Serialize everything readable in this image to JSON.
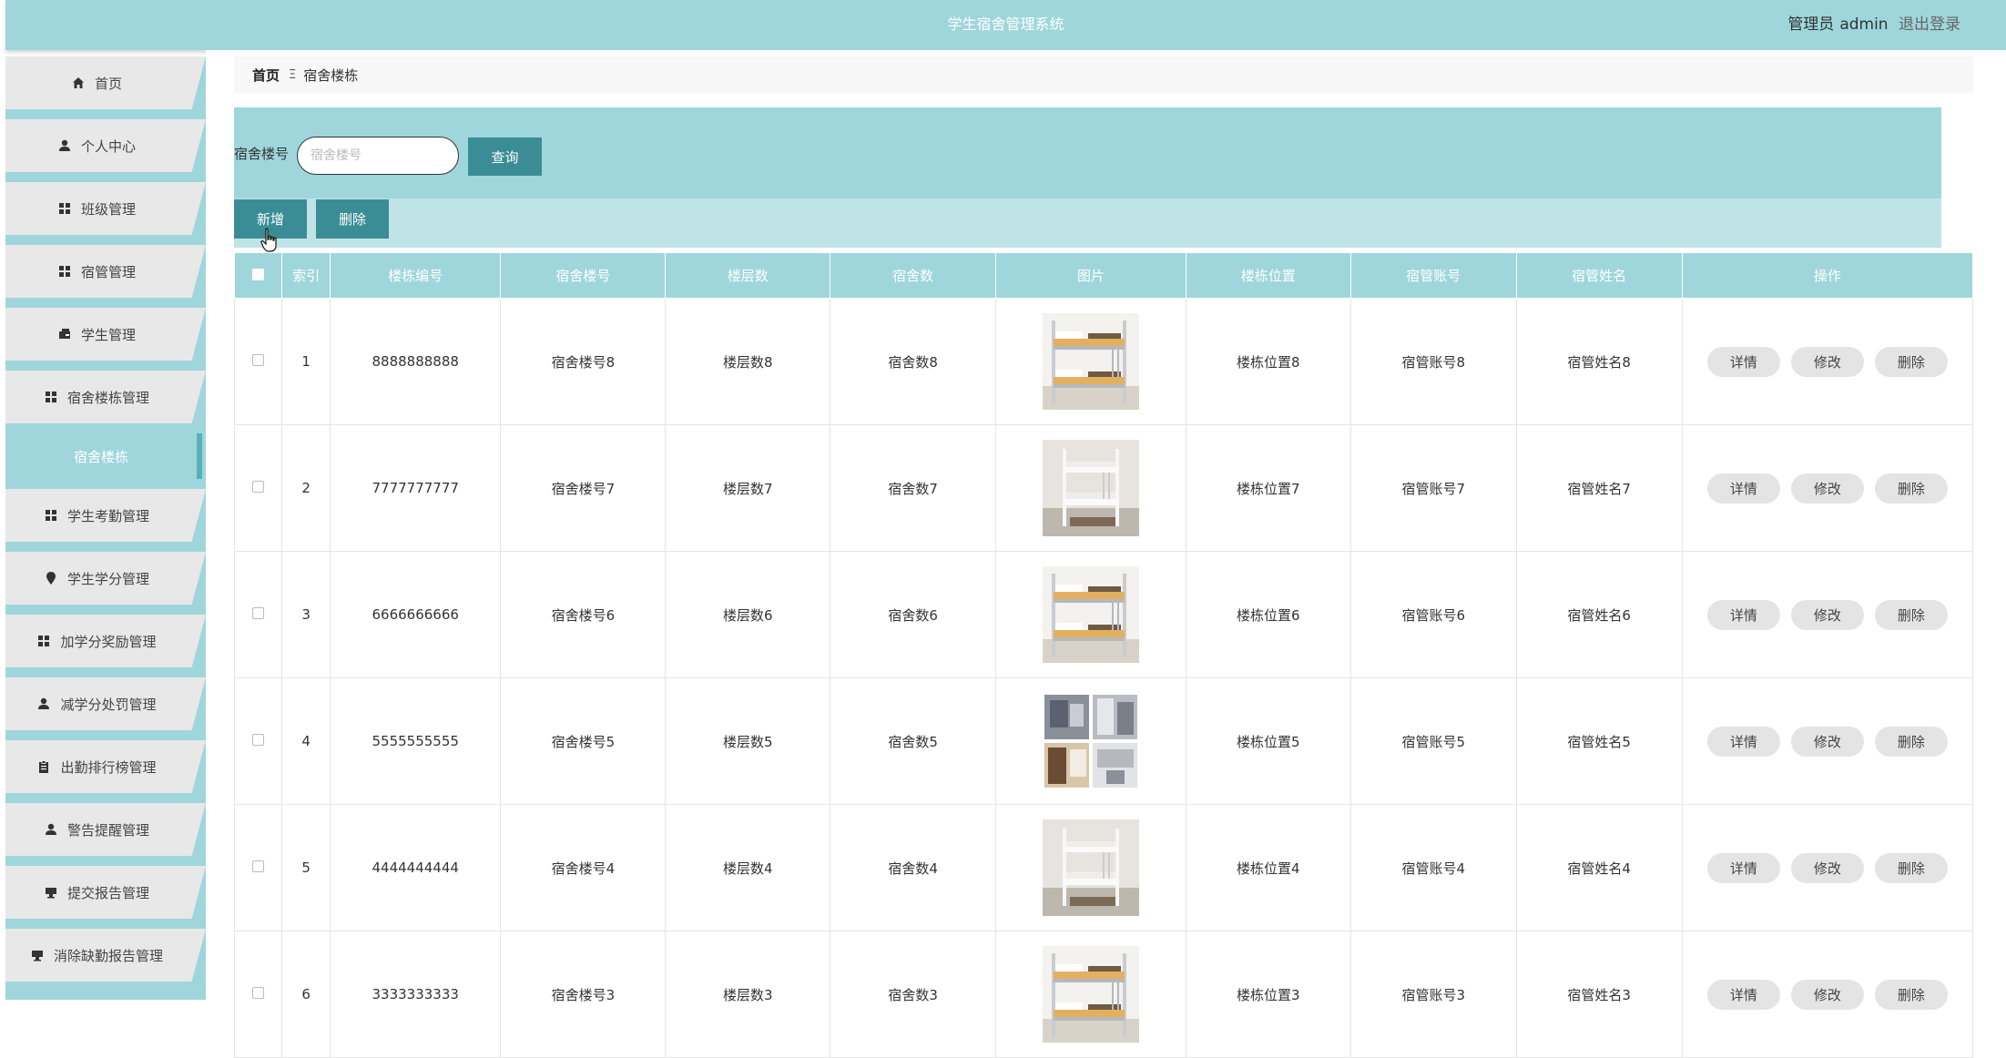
{
  "app": {
    "title": "学生宿舍管理系统",
    "user_role": "管理员",
    "user_name": "admin",
    "logout": "退出登录"
  },
  "sidebar": {
    "items": [
      {
        "label": "首页",
        "icon": "home-icon"
      },
      {
        "label": "个人中心",
        "icon": "user-icon"
      },
      {
        "label": "班级管理",
        "icon": "grid-icon"
      },
      {
        "label": "宿管管理",
        "icon": "grid-icon"
      },
      {
        "label": "学生管理",
        "icon": "id-card-icon"
      },
      {
        "label": "宿舍楼栋管理",
        "icon": "grid-icon"
      },
      {
        "label": "宿舍楼栋",
        "icon": "",
        "sub": true
      },
      {
        "label": "学生考勤管理",
        "icon": "grid-icon"
      },
      {
        "label": "学生学分管理",
        "icon": "pin-icon"
      },
      {
        "label": "加学分奖励管理",
        "icon": "grid-icon"
      },
      {
        "label": "减学分处罚管理",
        "icon": "user-icon"
      },
      {
        "label": "出勤排行榜管理",
        "icon": "clipboard-icon"
      },
      {
        "label": "警告提醒管理",
        "icon": "user-icon"
      },
      {
        "label": "提交报告管理",
        "icon": "monitor-icon"
      },
      {
        "label": "消除缺勤报告管理",
        "icon": "monitor-icon"
      }
    ]
  },
  "breadcrumb": {
    "home": "首页",
    "separator": "Ξ",
    "current": "宿舍楼栋"
  },
  "search": {
    "label": "宿舍楼号",
    "placeholder": "宿舍楼号",
    "query_button": "查询"
  },
  "actions": {
    "add": "新增",
    "delete": "删除"
  },
  "table": {
    "columns": [
      "索引",
      "楼栋编号",
      "宿舍楼号",
      "楼层数",
      "宿舍数",
      "图片",
      "楼栋位置",
      "宿管账号",
      "宿管姓名",
      "操作"
    ],
    "op_labels": {
      "detail": "详情",
      "edit": "修改",
      "delete": "删除"
    },
    "rows": [
      {
        "index": "1",
        "code": "8888888888",
        "building": "宿舍楼号8",
        "floors": "楼层数8",
        "rooms": "宿舍数8",
        "image": "bunk-bed-wood",
        "location": "楼栋位置8",
        "account": "宿管账号8",
        "name": "宿管姓名8"
      },
      {
        "index": "2",
        "code": "7777777777",
        "building": "宿舍楼号7",
        "floors": "楼层数7",
        "rooms": "宿舍数7",
        "image": "bunk-bed-white",
        "location": "楼栋位置7",
        "account": "宿管账号7",
        "name": "宿管姓名7"
      },
      {
        "index": "3",
        "code": "6666666666",
        "building": "宿舍楼号6",
        "floors": "楼层数6",
        "rooms": "宿舍数6",
        "image": "bunk-bed-wood",
        "location": "楼栋位置6",
        "account": "宿管账号6",
        "name": "宿管姓名6"
      },
      {
        "index": "4",
        "code": "5555555555",
        "building": "宿舍楼号5",
        "floors": "楼层数5",
        "rooms": "宿舍数5",
        "image": "room-collage",
        "location": "楼栋位置5",
        "account": "宿管账号5",
        "name": "宿管姓名5"
      },
      {
        "index": "5",
        "code": "4444444444",
        "building": "宿舍楼号4",
        "floors": "楼层数4",
        "rooms": "宿舍数4",
        "image": "bunk-bed-white",
        "location": "楼栋位置4",
        "account": "宿管账号4",
        "name": "宿管姓名4"
      },
      {
        "index": "6",
        "code": "3333333333",
        "building": "宿舍楼号3",
        "floors": "楼层数3",
        "rooms": "宿舍数3",
        "image": "bunk-bed-wood",
        "location": "楼栋位置3",
        "account": "宿管账号3",
        "name": "宿管姓名3"
      }
    ]
  },
  "colors": {
    "accent": "#9ed6dc",
    "button": "#3b8d95",
    "panel_light": "#bfe3e7"
  }
}
